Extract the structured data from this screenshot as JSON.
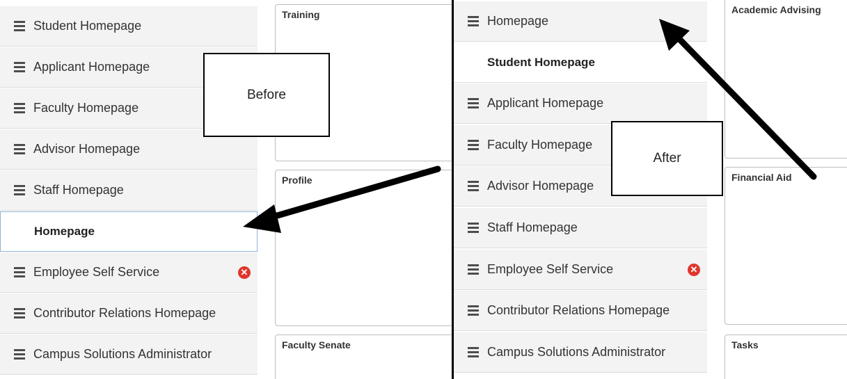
{
  "before": {
    "callout": "Before",
    "list": [
      {
        "label": "Student Homepage",
        "handle": true
      },
      {
        "label": "Applicant Homepage",
        "handle": true
      },
      {
        "label": "Faculty Homepage",
        "handle": true
      },
      {
        "label": "Advisor Homepage",
        "handle": true
      },
      {
        "label": "Staff Homepage",
        "handle": true
      },
      {
        "label": "Homepage",
        "handle": false,
        "selected": true
      },
      {
        "label": "Employee Self Service",
        "handle": true,
        "deletable": true
      },
      {
        "label": "Contributor Relations Homepage",
        "handle": true
      },
      {
        "label": "Campus Solutions Administrator",
        "handle": true
      }
    ],
    "tiles": [
      "Training",
      "Profile",
      "Faculty Senate"
    ]
  },
  "after": {
    "callout": "After",
    "list": [
      {
        "label": "Homepage",
        "handle": true
      },
      {
        "label": "Student Homepage",
        "handle": false
      },
      {
        "label": "Applicant Homepage",
        "handle": true
      },
      {
        "label": "Faculty Homepage",
        "handle": true
      },
      {
        "label": "Advisor Homepage",
        "handle": true
      },
      {
        "label": "Staff Homepage",
        "handle": true
      },
      {
        "label": "Employee Self Service",
        "handle": true,
        "deletable": true
      },
      {
        "label": "Contributor Relations Homepage",
        "handle": true
      },
      {
        "label": "Campus Solutions Administrator",
        "handle": true
      }
    ],
    "tiles": [
      "Academic Advising",
      "Financial Aid",
      "Tasks"
    ]
  },
  "icons": {
    "drag_handle": "drag-handle-icon",
    "delete": "delete-circle-icon"
  },
  "colors": {
    "delete_icon": "#e0362d",
    "selected_border": "#8fb1d8",
    "arrow": "#000000"
  }
}
